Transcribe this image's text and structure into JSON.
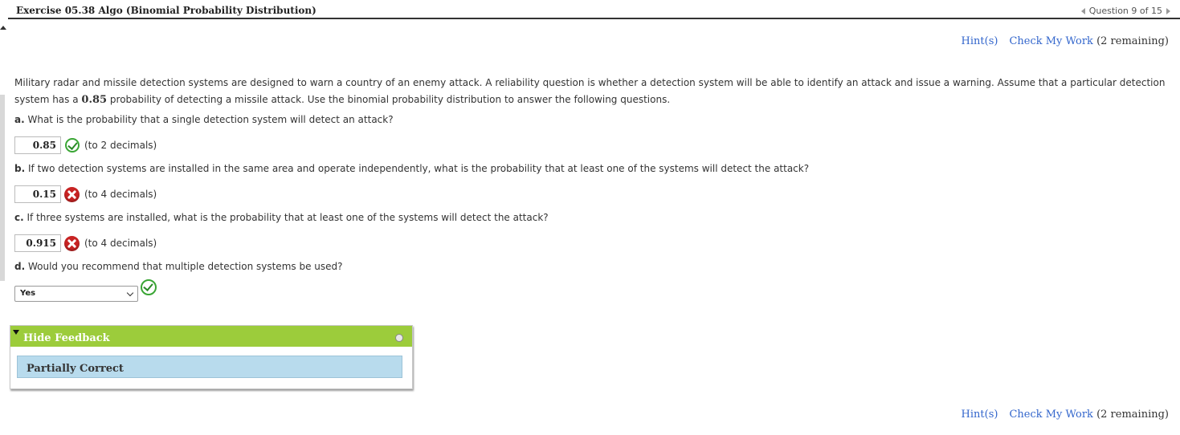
{
  "header": {
    "title": "Exercise 05.38 Algo (Binomial Probability Distribution)",
    "question_nav": "Question 9 of 15"
  },
  "links": {
    "hints": "Hint(s)",
    "check": "Check My Work",
    "remaining": "(2 remaining)"
  },
  "intro": {
    "line1": "Military radar and missile detection systems are designed to warn a country of an enemy attack. A reliability question is whether a detection system will be able to identify an attack and issue a warning. Assume that a particular detection",
    "line2_pre": "system has a",
    "line2_value": "0.85",
    "line2_post": "probability of detecting a missile attack. Use the binomial probability distribution to answer the following questions."
  },
  "questions": [
    {
      "letter": "a.",
      "text": "What is the probability that a single detection system will detect an attack?",
      "answer": "0.85",
      "hint": "(to 2 decimals)",
      "status": "correct"
    },
    {
      "letter": "b.",
      "text": "If two detection systems are installed in the same area and operate independently, what is the probability that at least one of the systems will detect the attack?",
      "answer": "0.15",
      "hint": "(to 4 decimals)",
      "status": "incorrect"
    },
    {
      "letter": "c.",
      "text": "If three systems are installed, what is the probability that at least one of the systems will detect the attack?",
      "answer": "0.915",
      "hint": "(to 4 decimals)",
      "status": "incorrect"
    },
    {
      "letter": "d.",
      "text": "Would you recommend that multiple detection systems be used?",
      "answer": "Yes",
      "status": "correct"
    }
  ],
  "feedback": {
    "toggle_label": "Hide Feedback",
    "status": "Partially Correct"
  },
  "colors": {
    "link": "#3366cc",
    "feedback_header": "#9ccc3b",
    "feedback_body": "#b8dbed",
    "correct": "#3aa635",
    "incorrect": "#c82323"
  }
}
